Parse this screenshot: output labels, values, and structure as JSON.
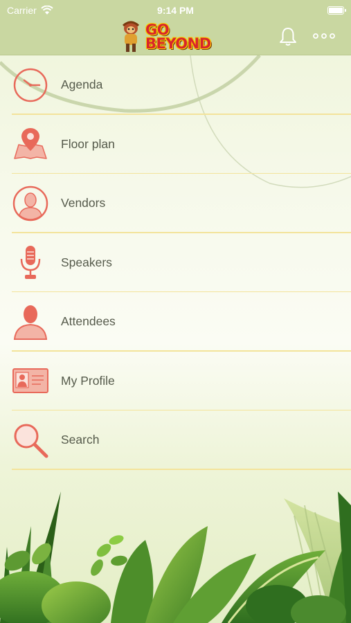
{
  "status_bar": {
    "carrier": "Carrier",
    "time": "9:14 PM",
    "icons": [
      "wifi-icon",
      "battery-icon"
    ]
  },
  "nav_bar": {
    "logo_line1": "GO",
    "logo_line2": "BEYOND",
    "icons": [
      "bell-icon",
      "more-options-icon"
    ]
  },
  "menu": {
    "items": [
      {
        "label": "Agenda",
        "icon": "clock-icon"
      },
      {
        "label": "Floor plan",
        "icon": "map-pin-icon"
      },
      {
        "label": "Vendors",
        "icon": "vendor-person-icon"
      },
      {
        "label": "Speakers",
        "icon": "microphone-icon"
      },
      {
        "label": "Attendees",
        "icon": "person-icon"
      },
      {
        "label": "My Profile",
        "icon": "id-card-icon"
      },
      {
        "label": "Search",
        "icon": "magnifier-icon"
      }
    ]
  },
  "colors": {
    "accent": "#e8695a",
    "nav_background": "#c9d7a1",
    "divider": "#f3e39a",
    "text": "#555a4b"
  }
}
